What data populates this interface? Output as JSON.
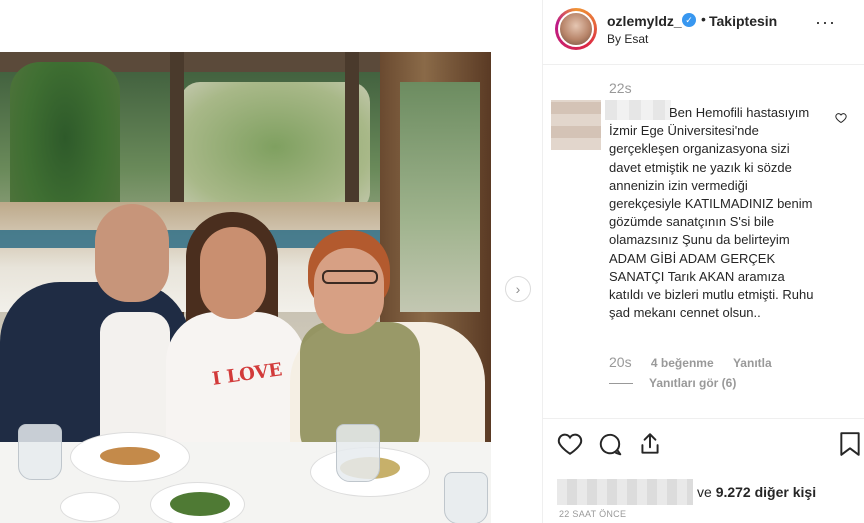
{
  "post": {
    "photo_caption_text": "I LOVE"
  },
  "header": {
    "username": "ozlemyldz_",
    "separator": "•",
    "follow_label": "Takiptesin",
    "byline": "By Esat",
    "more": "···"
  },
  "comment": {
    "time_top": "22s",
    "text": "Ben Hemofili hastasıyım İzmir Ege Üniversitesi'nde gerçekleşen organizasyona sizi davet etmiştik ne yazık ki sözde annenizin izin vermediği gerekçesiyle KATILMADINIZ benim gözümde sanatçının S'si bile olamazsınız Şunu da belirteyim ADAM GİBİ ADAM GERÇEK SANATÇI Tarık AKAN aramıza katıldı ve bizleri mutlu etmişti. Ruhu şad mekanı cennet olsun..",
    "time": "20s",
    "likes": "4 beğenme",
    "reply": "Yanıtla",
    "view_replies": "Yanıtları gör (6)"
  },
  "actions": {
    "likes_suffix_prefix": "ve",
    "likes_count": "9.272 diğer kişi",
    "time_ago": "22 SAAT ÖNCE"
  },
  "icons": {
    "next": "chevron-right-icon",
    "like": "heart-icon",
    "comment": "comment-icon",
    "share": "share-icon",
    "save": "bookmark-icon"
  }
}
